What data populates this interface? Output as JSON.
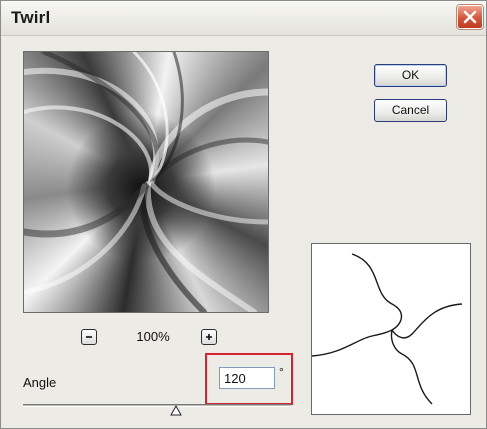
{
  "window": {
    "title": "Twirl"
  },
  "buttons": {
    "ok_label": "OK",
    "cancel_label": "Cancel"
  },
  "zoom": {
    "level": "100%"
  },
  "angle": {
    "label": "Angle",
    "value": "120",
    "unit": "°",
    "slider_fraction": 0.57
  },
  "icons": {
    "close": "close-icon",
    "zoom_out": "minus-icon",
    "zoom_in": "plus-icon",
    "slider_thumb": "triangle-thumb-icon"
  },
  "colors": {
    "dialog_bg": "#ecebe6",
    "close_button": "#d5553a",
    "highlight_box": "#d8232f",
    "button_border": "#2a3c7a"
  }
}
